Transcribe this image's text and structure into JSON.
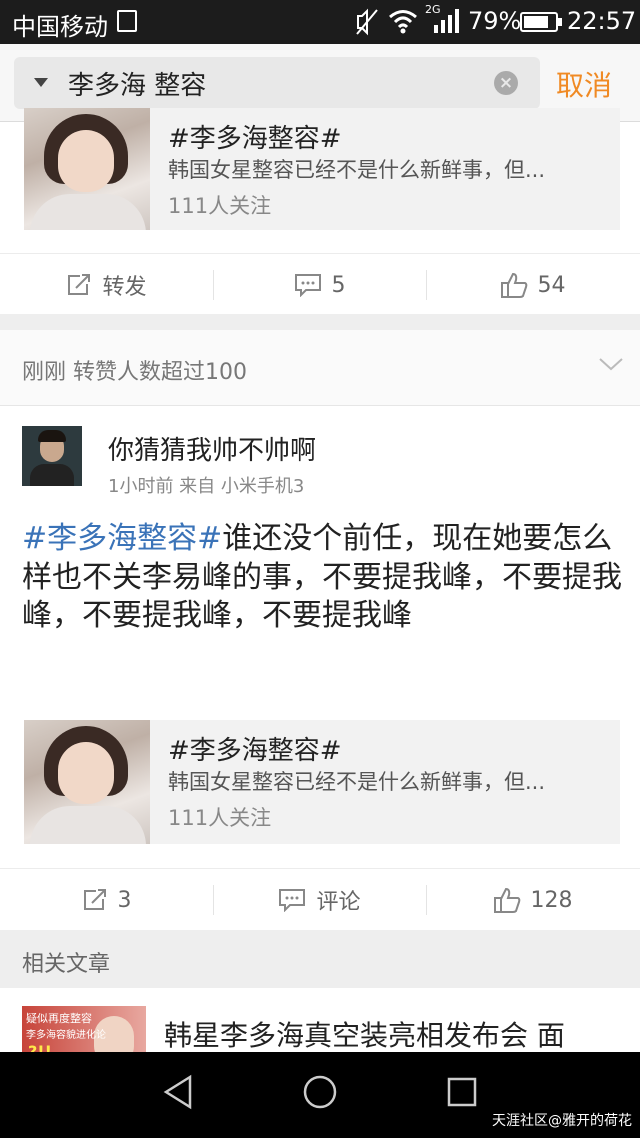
{
  "status_bar": {
    "carrier": "中国移动",
    "network": "2G",
    "battery": "79%",
    "battery_level": 0.79,
    "time": "22:57"
  },
  "search": {
    "query": "李多海 整容",
    "cancel_label": "取消"
  },
  "post1": {
    "topic": {
      "title": "#李多海整容#",
      "description": "韩国女星整容已经不是什么新鲜事，但...",
      "followers": "111人关注"
    },
    "actions": {
      "repost": "转发",
      "comments": "5",
      "likes": "54"
    }
  },
  "notice": {
    "text": "刚刚 转赞人数超过100"
  },
  "post2": {
    "username": "你猜猜我帅不帅啊",
    "meta": "1小时前  来自 小米手机3",
    "hashtag": "#李多海整容#",
    "body": "谁还没个前任，现在她要怎么样也不关李易峰的事，不要提我峰，不要提我峰，不要提我峰，不要提我峰",
    "topic": {
      "title": "#李多海整容#",
      "description": "韩国女星整容已经不是什么新鲜事，但...",
      "followers": "111人关注"
    },
    "actions": {
      "reposts": "3",
      "comment": "评论",
      "likes": "128"
    }
  },
  "related": {
    "heading": "相关文章",
    "article_title": "韩星李多海真空装亮相发布会 面",
    "thumb_line1": "疑似再度整容",
    "thumb_line2": "李多海容貌进化论",
    "thumb_line3": "?!!"
  },
  "watermark": "天涯社区@雅开的荷花",
  "colors": {
    "accent": "#f08a24",
    "hashtag": "#3a73b8"
  }
}
